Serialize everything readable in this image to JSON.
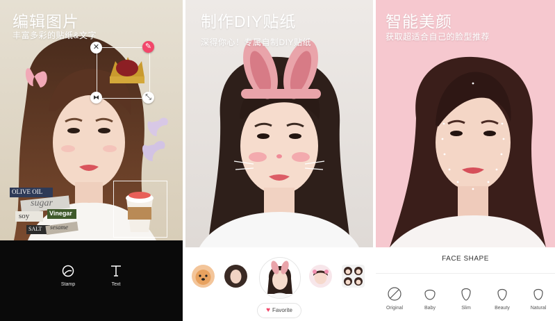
{
  "panels": [
    {
      "title": "编辑图片",
      "subtitle": "丰富多彩的贴纸&文字",
      "stickers": {
        "words": [
          "OLIVE OIL",
          "sugar",
          "Vinegar",
          "soy",
          "SALT",
          "sesame"
        ]
      },
      "tools": [
        {
          "label": "Stamp",
          "icon": "stamp-icon"
        },
        {
          "label": "Text",
          "icon": "text-icon"
        }
      ]
    },
    {
      "title": "制作DIY贴纸",
      "subtitle": "深得你心！专属自制DIY贴纸",
      "favorite_label": "Favorite",
      "thumbnails": [
        "dog-avatar",
        "woman-avatar",
        "bunny-ears-avatar",
        "cartoon-avatar",
        "sticker-grid-avatar"
      ]
    },
    {
      "title": "智能美颜",
      "subtitle": "获取超适合自己的脸型推荐",
      "face_shape_title": "FACE SHAPE",
      "shapes": [
        {
          "label": "Original"
        },
        {
          "label": "Baby"
        },
        {
          "label": "Slim"
        },
        {
          "label": "Beauty"
        },
        {
          "label": "Natural"
        }
      ]
    }
  ],
  "colors": {
    "accent_pink": "#f2476a",
    "panel3_bg": "#f6c8cf",
    "toolbar_bg": "#0a0a0a"
  }
}
